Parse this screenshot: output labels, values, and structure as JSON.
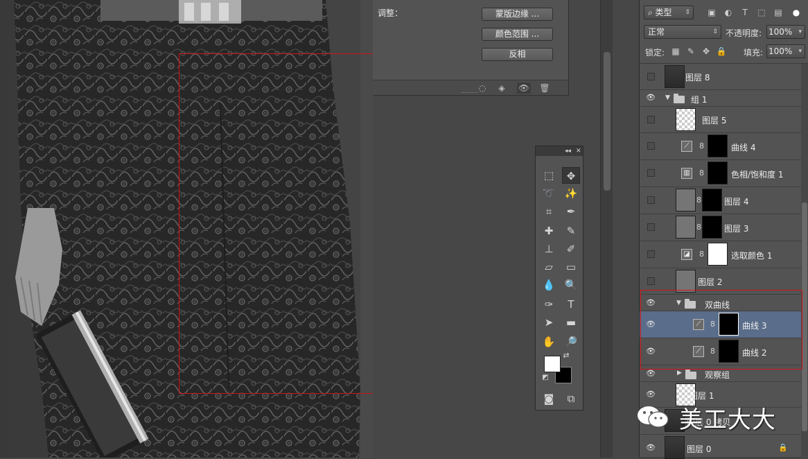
{
  "properties_panel": {
    "adjust_label": "调整：",
    "buttons": [
      "蒙版边缘 ...",
      "颜色范围 ...",
      "反相"
    ]
  },
  "layers_panel": {
    "filter_kind": "类型",
    "blend_mode": "正常",
    "opacity_label": "不透明度:",
    "opacity_value": "100%",
    "lock_label": "锁定:",
    "fill_label": "填充:",
    "fill_value": "100%",
    "layers": [
      {
        "name": "图层 8",
        "visible": false
      },
      {
        "name": "组 1",
        "visible": true,
        "group": true,
        "expanded": true
      },
      {
        "name": "图层 5",
        "visible": false
      },
      {
        "name": "曲线 4",
        "visible": false
      },
      {
        "name": "色相/饱和度 1",
        "visible": false
      },
      {
        "name": "图层 4",
        "visible": false
      },
      {
        "name": "图层 3",
        "visible": false
      },
      {
        "name": "选取颜色 1",
        "visible": false
      },
      {
        "name": "图层 2",
        "visible": false
      },
      {
        "name": "双曲线",
        "visible": true,
        "group": true,
        "expanded": true
      },
      {
        "name": "曲线 3",
        "visible": true,
        "selected": true
      },
      {
        "name": "曲线 2",
        "visible": true
      },
      {
        "name": "观察组",
        "visible": true,
        "group": true,
        "expanded": false
      },
      {
        "name": "图层 1",
        "visible": true
      },
      {
        "name": "图层 0 拷贝",
        "visible": true
      },
      {
        "name": "图层 0",
        "visible": true,
        "locked": true
      }
    ]
  },
  "watermark": {
    "text": "美工大大"
  },
  "colors": {
    "highlight_red": "#d0141a",
    "selected_row": "#5a6d8a",
    "panel_bg": "#535353"
  }
}
